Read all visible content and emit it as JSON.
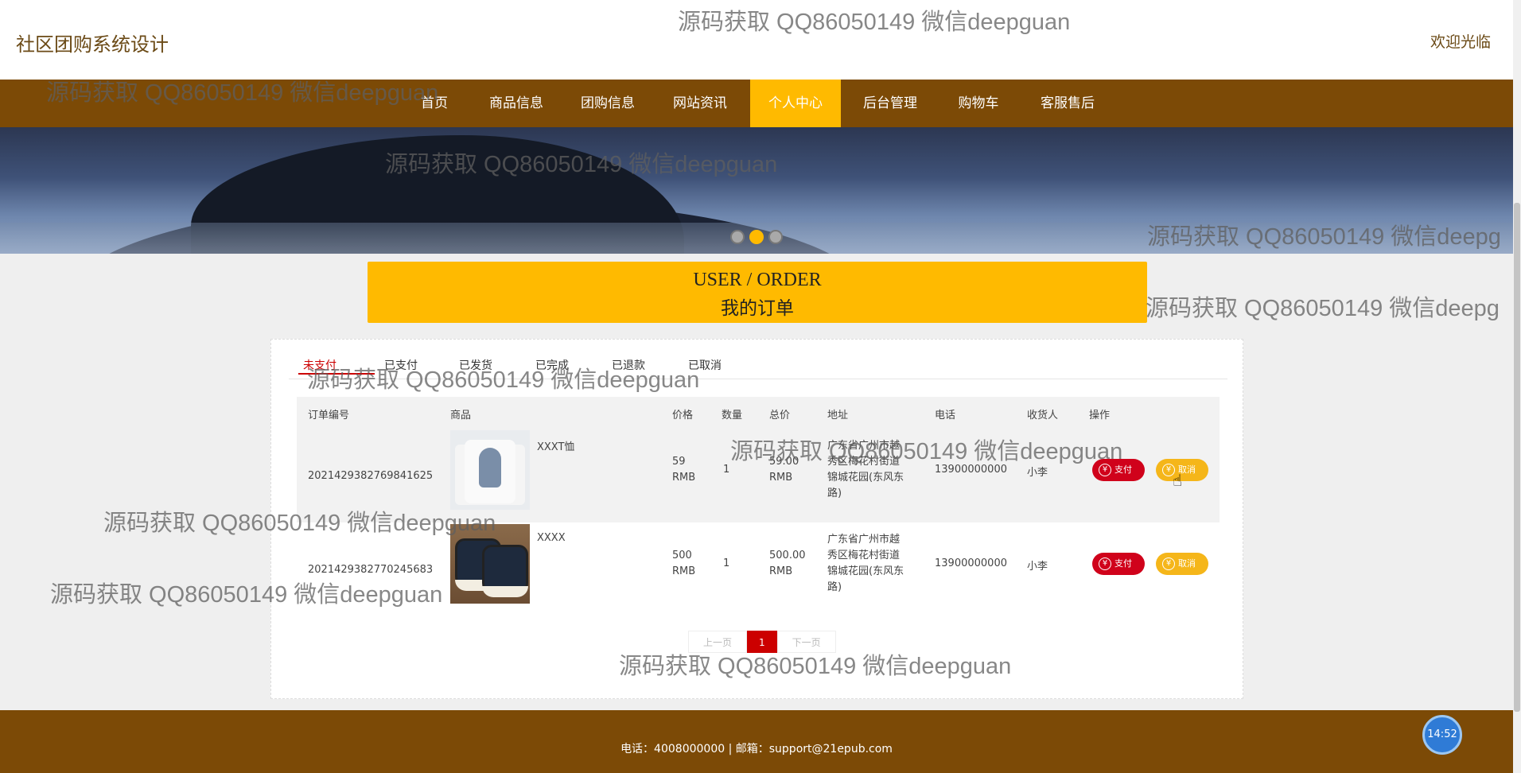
{
  "header": {
    "site_title": "社区团购系统设计",
    "welcome": "欢迎光临"
  },
  "nav": {
    "items": [
      {
        "label": "首页"
      },
      {
        "label": "商品信息"
      },
      {
        "label": "团购信息"
      },
      {
        "label": "网站资讯"
      },
      {
        "label": "个人中心",
        "active": true
      },
      {
        "label": "后台管理"
      },
      {
        "label": "购物车"
      },
      {
        "label": "客服售后"
      }
    ]
  },
  "banner": {
    "slide_count": 3,
    "active_slide": 2
  },
  "order_header": {
    "title_en": "USER / ORDER",
    "title_cn": "我的订单"
  },
  "tabs": [
    {
      "label": "未支付",
      "active": true
    },
    {
      "label": "已支付"
    },
    {
      "label": "已发货"
    },
    {
      "label": "已完成"
    },
    {
      "label": "已退款"
    },
    {
      "label": "已取消"
    }
  ],
  "table": {
    "columns": [
      "订单编号",
      "商品",
      "价格",
      "数量",
      "总价",
      "地址",
      "电话",
      "收货人",
      "操作"
    ],
    "rows": [
      {
        "order_no": "2021429382769841625",
        "product": "XXXT恤",
        "price": "59",
        "price_unit": "RMB",
        "qty": "1",
        "total": "59.00",
        "total_unit": "RMB",
        "address_lines": [
          "广东省广州市越",
          "秀区梅花村街道",
          "锦城花园(东风东",
          "路)"
        ],
        "phone": "13900000000",
        "receiver": "小李",
        "pay_label": "支付",
        "cancel_label": "取消",
        "image": "tshirt-image"
      },
      {
        "order_no": "2021429382770245683",
        "product": "XXXX",
        "price": "500",
        "price_unit": "RMB",
        "qty": "1",
        "total": "500.00",
        "total_unit": "RMB",
        "address_lines": [
          "广东省广州市越",
          "秀区梅花村街道",
          "锦城花园(东风东",
          "路)"
        ],
        "phone": "13900000000",
        "receiver": "小李",
        "pay_label": "支付",
        "cancel_label": "取消",
        "image": "sneakers-image"
      }
    ]
  },
  "pager": {
    "prev": "上一页",
    "current": "1",
    "next": "下一页"
  },
  "footer": {
    "text": "电话：4008000000 | 邮箱：support@21epub.com"
  },
  "clock": {
    "time": "14:52"
  },
  "watermark": {
    "text": "源码获取 QQ86050149 微信deepguan",
    "text_cut1": "源码获取 QQ86050149 微信deepg",
    "text_cut2": "源码获取 QQ86050149 微信deepg"
  },
  "colors": {
    "brand_brown": "#7c4a06",
    "accent_yellow": "#ffba00",
    "pay_red": "#d0021b",
    "cancel_yellow": "#f5b61a"
  }
}
